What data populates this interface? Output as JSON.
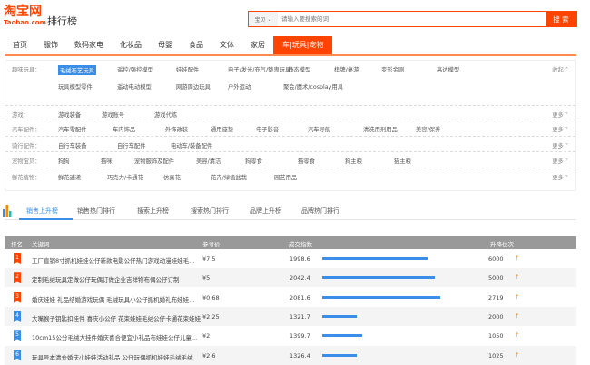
{
  "header": {
    "logo_cn": "淘宝网",
    "logo_en": "Taobao.com",
    "title": "排行榜",
    "search_scope": "宝贝",
    "search_placeholder": "请输入要搜索的词",
    "search_button": "搜 索"
  },
  "nav": [
    "首页",
    "服饰",
    "数码家电",
    "化妆品",
    "母婴",
    "食品",
    "文体",
    "家居",
    "车|玩具|宠物"
  ],
  "categories": [
    {
      "label": "趣味玩具：",
      "items": [
        "毛绒布艺玩具",
        "遥控/强控模型",
        "娃娃配件",
        "电子/发光/充气/整蛊玩具",
        "静态模型",
        "棋牌/桌游",
        "变形金刚",
        "高达模型",
        "玩具模型零件",
        "遥动电动模型",
        "网游周边玩具",
        "户外运动",
        "聚会/魔术/cosplay用具"
      ],
      "toggle": "收起"
    },
    {
      "label": "游戏：",
      "items": [
        "游戏装备",
        "游戏账号",
        "游戏代练"
      ],
      "toggle": "更多"
    },
    {
      "label": "汽车配件：",
      "items": [
        "汽车零配件",
        "车内饰品",
        "外饰改装",
        "通用座垫",
        "电子影音",
        "汽车导航",
        "清洗用剂用品",
        "美容/保养"
      ],
      "toggle": "更多"
    },
    {
      "label": "骑行配件：",
      "items": [
        "自行车装备",
        "自行车配件",
        "电动车/装备配件"
      ],
      "toggle": "更多"
    },
    {
      "label": "宠物宝贝：",
      "items": [
        "狗狗",
        "猫咪",
        "宠物服饰及配件",
        "美容/清洁",
        "狗零食",
        "猫零食",
        "狗主粮",
        "猫主粮"
      ],
      "toggle": "更多"
    },
    {
      "label": "鲜花植物：",
      "items": [
        "鲜花速递",
        "巧克力/卡通花",
        "仿真花",
        "花卉/绿植盆栽",
        "园艺用品"
      ],
      "toggle": "更多"
    }
  ],
  "tabs": [
    "销售上升榜",
    "销售热门排行",
    "搜索上升榜",
    "搜索热门排行",
    "品牌上升榜",
    "品牌热门排行"
  ],
  "table": {
    "headers": [
      "排名",
      "关键词",
      "参考价",
      "成交指数",
      "升降位次"
    ],
    "rows": [
      {
        "rank": "1",
        "keyword": "工厂直销8寸抓机娃娃公仔新款电影公仔热门游戏动漫娃娃毛...",
        "price": "¥7.5",
        "index": "1998.6",
        "change": "6000",
        "bar": 0.55
      },
      {
        "rank": "2",
        "keyword": "定制毛绒玩具定做公仔玩偶订做企业吉祥物布偶公仔订制",
        "price": "¥5",
        "index": "2042.4",
        "change": "5000",
        "bar": 0.59
      },
      {
        "rank": "3",
        "keyword": "婚庆娃娃 礼品结婚游戏玩偶 毛绒玩具小公仔抓机婚礼布娃娃...",
        "price": "¥0.68",
        "index": "2081.6",
        "change": "2719",
        "bar": 0.62
      },
      {
        "rank": "4",
        "keyword": "大嘴猴子钥匙扣挂件 喜庆小公仔 花束娃娃毛绒公仔卡通花束娃娃",
        "price": "¥2.25",
        "index": "1321.7",
        "change": "2000",
        "bar": 0.18
      },
      {
        "rank": "5",
        "keyword": "10cm15公分毛绒大挂件婚庆喜合便宜小礼品布娃娃公仔儿童...",
        "price": "¥2",
        "index": "1399.7",
        "change": "1050",
        "bar": 0.21
      },
      {
        "rank": "6",
        "keyword": "玩具号本清仓婚庆小娃娃活动礼品 公仔玩偶抓机娃娃毛绒毛绒",
        "price": "¥2.6",
        "index": "1326.4",
        "change": "1025",
        "bar": 0.18
      }
    ]
  },
  "up_arrow": "↑",
  "colors": {
    "brand": "#ff4400",
    "accent": "#3b8ee8",
    "top3": "#ff4400",
    "other": "#3b8ee8"
  }
}
